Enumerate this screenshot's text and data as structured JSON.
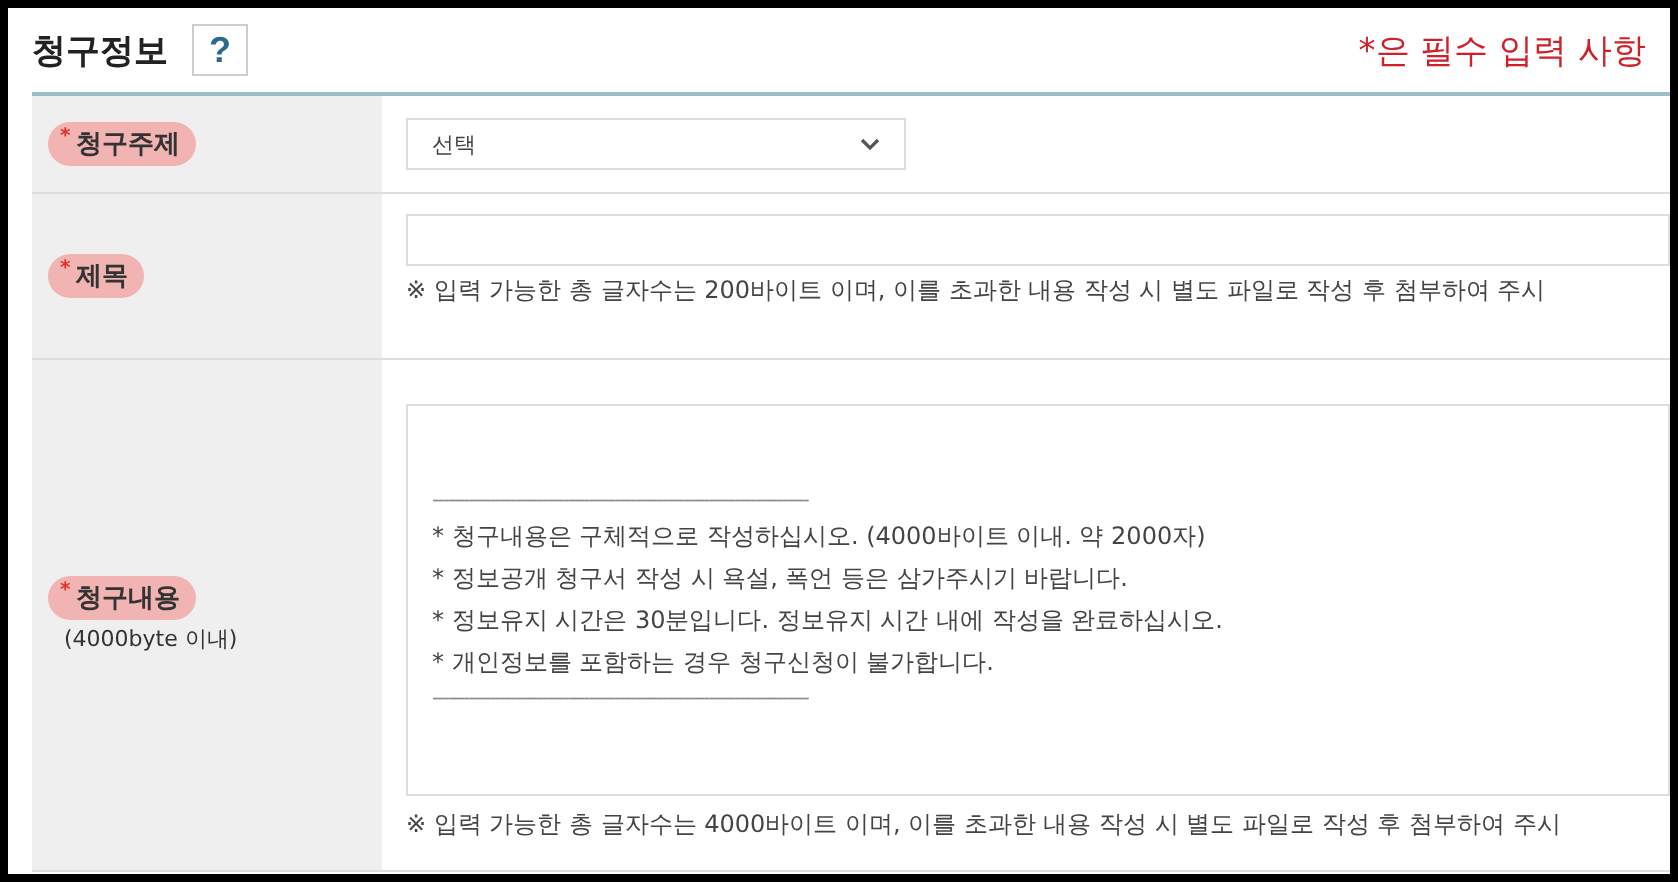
{
  "section": {
    "title": "청구정보",
    "help_button": "?",
    "required_note": "*은 필수 입력 사항"
  },
  "rows": [
    {
      "kind": "select",
      "label": "청구주제",
      "required_mark": "*",
      "value": "선택"
    },
    {
      "kind": "text",
      "label": "제목",
      "required_mark": "*",
      "note": "※ 입력 가능한 총 글자수는 200바이트 이며, 이를 초과한 내용 작성 시 별도 파일로 작성 후 첨부하여 주시"
    },
    {
      "kind": "textarea",
      "label": "청구내용",
      "required_mark": "*",
      "sublabel": "(4000byte 이내)",
      "divider": "------------------------------------------------------------------------",
      "lines": [
        "* 청구내용은 구체적으로 작성하십시오. (4000바이트 이내. 약 2000자)",
        "* 정보공개 청구서 작성 시 욕설, 폭언 등은 삼가주시기 바랍니다.",
        "* 정보유지 시간은 30분입니다. 정보유지 시간 내에 작성을 완료하십시오.",
        "* 개인정보를 포함하는 경우 청구신청이 불가합니다."
      ],
      "note": "※ 입력 가능한 총 글자수는 4000바이트 이며, 이를 초과한 내용 작성 시 별도 파일로 작성 후 첨부하여 주시"
    }
  ]
}
